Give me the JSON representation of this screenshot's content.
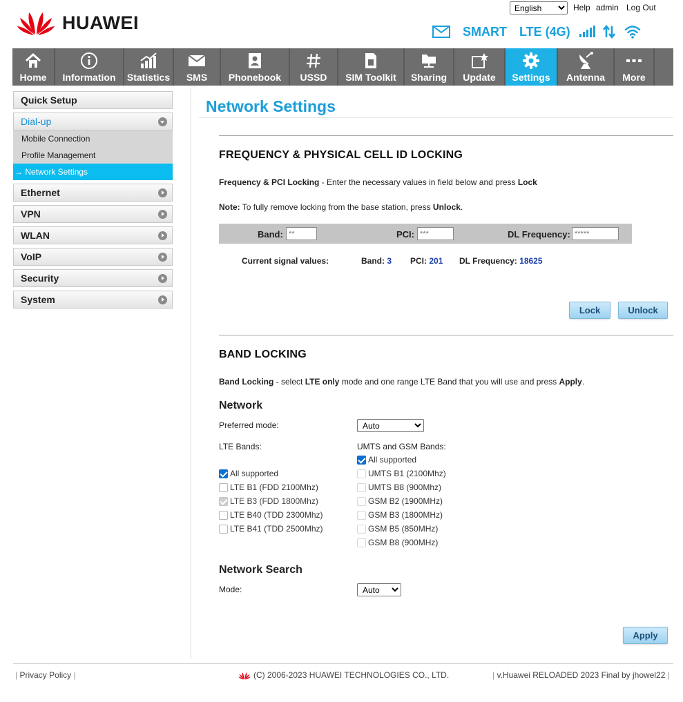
{
  "header": {
    "brand": "HUAWEI",
    "language": "English",
    "language_options": [
      "English"
    ],
    "help": "Help",
    "user": "admin",
    "logout": "Log Out",
    "operator": "SMART",
    "network_type": "LTE (4G)"
  },
  "nav": {
    "items": [
      {
        "label": "Home",
        "icon": "home-icon"
      },
      {
        "label": "Information",
        "icon": "info-icon"
      },
      {
        "label": "Statistics",
        "icon": "statistics-icon"
      },
      {
        "label": "SMS",
        "icon": "envelope-icon"
      },
      {
        "label": "Phonebook",
        "icon": "phonebook-icon"
      },
      {
        "label": "USSD",
        "icon": "hash-icon"
      },
      {
        "label": "SIM Toolkit",
        "icon": "sim-icon"
      },
      {
        "label": "Sharing",
        "icon": "sharing-icon"
      },
      {
        "label": "Update",
        "icon": "update-icon"
      },
      {
        "label": "Settings",
        "icon": "gear-icon"
      },
      {
        "label": "Antenna",
        "icon": "antenna-icon"
      },
      {
        "label": "More",
        "icon": "more-icon"
      }
    ],
    "active": "Settings"
  },
  "sidebar": {
    "quick_setup": "Quick Setup",
    "dialup": "Dial-up",
    "dialup_items": [
      "Mobile Connection",
      "Profile Management",
      "→ Network Settings"
    ],
    "sections": [
      "Ethernet",
      "VPN",
      "WLAN",
      "VoIP",
      "Security",
      "System"
    ]
  },
  "main": {
    "title": "Network Settings",
    "freq": {
      "heading": "FREQUENCY & PHYSICAL CELL ID LOCKING",
      "desc_bold": "Frequency & PCI Locking",
      "desc_text": " - Enter the necessary values in field below and press ",
      "desc_lock": "Lock",
      "note_bold": "Note:",
      "note_text": " To fully remove locking from the base station, press ",
      "note_unlock": "Unlock",
      "band_label": "Band:",
      "band_placeholder": "**",
      "pci_label": "PCI:",
      "pci_placeholder": "***",
      "dl_label": "DL Frequency:",
      "dl_placeholder": "*****",
      "current_label": "Current signal values:",
      "cur_band_label": "Band:",
      "cur_band": "3",
      "cur_pci_label": "PCI:",
      "cur_pci": "201",
      "cur_dl_label": "DL Frequency:",
      "cur_dl": "18625",
      "lock_button": "Lock",
      "unlock_button": "Unlock"
    },
    "band": {
      "heading": "BAND LOCKING",
      "desc_bold": "Band Locking",
      "desc_1": " - select ",
      "desc_lte_only": "LTE only",
      "desc_2": " mode and one range LTE Band that you will use and press ",
      "desc_apply": "Apply",
      "desc_end": ".",
      "network_heading": "Network",
      "preferred_mode_label": "Preferred mode:",
      "preferred_mode_value": "Auto",
      "lte_bands_label": "LTE Bands:",
      "umts_gsm_label": "UMTS and GSM Bands:",
      "lte_bands": [
        {
          "label": "All supported",
          "state": "checked"
        },
        {
          "label": "LTE B1 (FDD 2100Mhz)",
          "state": "unchecked"
        },
        {
          "label": "LTE B3 (FDD 1800Mhz)",
          "state": "disabled-checked"
        },
        {
          "label": "LTE B40 (TDD 2300Mhz)",
          "state": "unchecked"
        },
        {
          "label": "LTE B41 (TDD 2500Mhz)",
          "state": "unchecked"
        }
      ],
      "umts_bands": [
        {
          "label": "All supported",
          "state": "checked"
        },
        {
          "label": "UMTS B1 (2100Mhz)",
          "state": "unchecked"
        },
        {
          "label": "UMTS B8 (900Mhz)",
          "state": "unchecked"
        },
        {
          "label": "GSM B2 (1900MHz)",
          "state": "unchecked"
        },
        {
          "label": "GSM B3 (1800MHz)",
          "state": "unchecked"
        },
        {
          "label": "GSM B5 (850MHz)",
          "state": "unchecked"
        },
        {
          "label": "GSM B8 (900MHz)",
          "state": "unchecked"
        }
      ],
      "search_heading": "Network Search",
      "mode_label": "Mode:",
      "mode_value": "Auto",
      "apply_button": "Apply"
    }
  },
  "footer": {
    "privacy": "Privacy Policy",
    "copyright": "(C) 2006-2023 HUAWEI TECHNOLOGIES CO., LTD.",
    "version": "v.Huawei RELOADED 2023 Final by jhowel22"
  },
  "colors": {
    "accent": "#1eb1e6",
    "title_blue": "#1c9ed8",
    "nav_bg": "#6e6e6e",
    "value_blue": "#1c3fa8",
    "brand_red": "#e60012"
  }
}
